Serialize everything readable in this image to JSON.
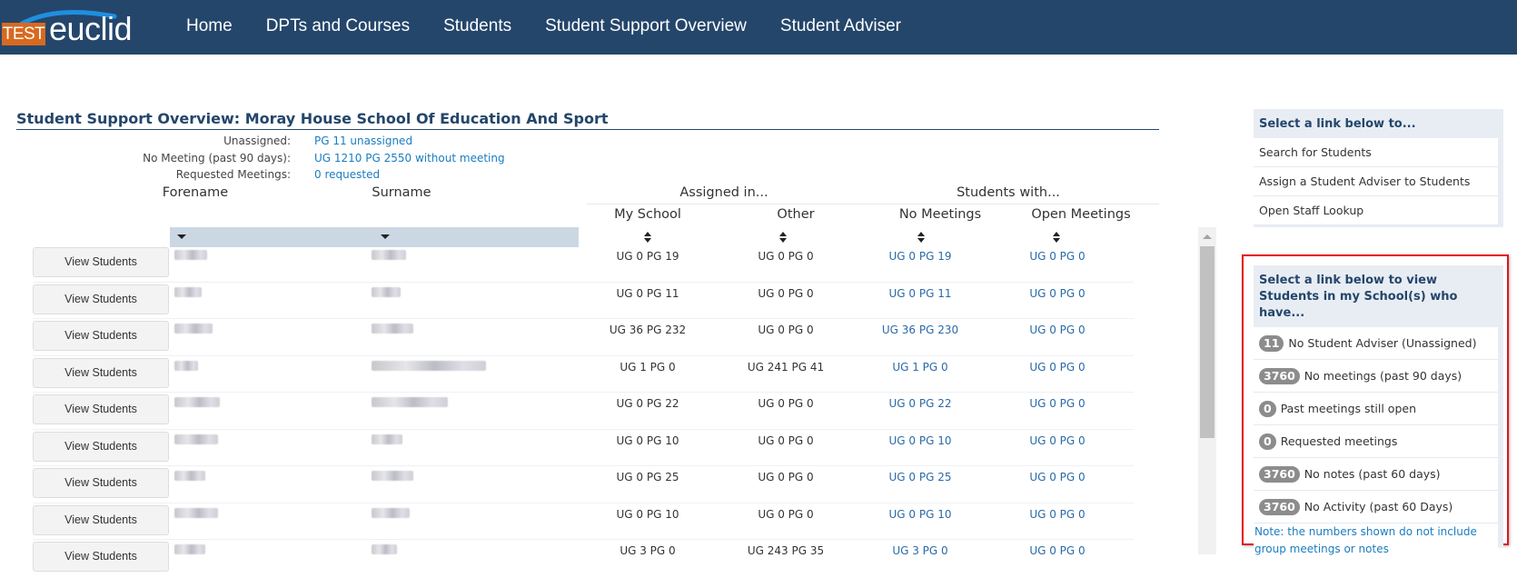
{
  "app": {
    "logo_prefix": "TEST",
    "logo_name": "euclid",
    "brand_color": "#24466b",
    "logo_accent": "#d8691f"
  },
  "nav": {
    "items": [
      {
        "label": "Home"
      },
      {
        "label": "DPTs and Courses"
      },
      {
        "label": "Students"
      },
      {
        "label": "Student Support Overview"
      },
      {
        "label": "Student Adviser"
      }
    ]
  },
  "main": {
    "title": "Student Support Overview: Moray House School Of Education And Sport",
    "summary": [
      {
        "label": "Unassigned:",
        "value": "PG 11 unassigned"
      },
      {
        "label": "No Meeting (past 90 days):",
        "value": "UG 1210 PG 2550 without meeting"
      },
      {
        "label": "Requested Meetings:",
        "value": "0 requested"
      }
    ],
    "table": {
      "columns": {
        "forename": "Forename",
        "surname": "Surname",
        "group_assigned": "Assigned in...",
        "group_students": "Students with...",
        "my_school": "My School",
        "other": "Other",
        "no_meetings": "No Meetings",
        "open_meetings": "Open Meetings"
      },
      "row_button_label": "View Students",
      "rows": [
        {
          "forename": "(redacted)",
          "surname": "(redacted)",
          "my_school": "UG 0 PG 19",
          "other": "UG 0 PG 0",
          "no_meetings": "UG 0 PG 19",
          "open_meetings": "UG 0 PG 0"
        },
        {
          "forename": "(redacted)",
          "surname": "(redacted)",
          "my_school": "UG 0 PG 11",
          "other": "UG 0 PG 0",
          "no_meetings": "UG 0 PG 11",
          "open_meetings": "UG 0 PG 0"
        },
        {
          "forename": "(redacted)",
          "surname": "(redacted)",
          "my_school": "UG 36 PG 232",
          "other": "UG 0 PG 0",
          "no_meetings": "UG 36 PG 230",
          "open_meetings": "UG 0 PG 0"
        },
        {
          "forename": "(redacted)",
          "surname": "(redacted)",
          "my_school": "UG 1 PG 0",
          "other": "UG 241 PG 41",
          "no_meetings": "UG 1 PG 0",
          "open_meetings": "UG 0 PG 0"
        },
        {
          "forename": "(redacted)",
          "surname": "(redacted)",
          "my_school": "UG 0 PG 22",
          "other": "UG 0 PG 0",
          "no_meetings": "UG 0 PG 22",
          "open_meetings": "UG 0 PG 0"
        },
        {
          "forename": "(redacted)",
          "surname": "(redacted)",
          "my_school": "UG 0 PG 10",
          "other": "UG 0 PG 0",
          "no_meetings": "UG 0 PG 10",
          "open_meetings": "UG 0 PG 0"
        },
        {
          "forename": "(redacted)",
          "surname": "(redacted)",
          "my_school": "UG 0 PG 25",
          "other": "UG 0 PG 0",
          "no_meetings": "UG 0 PG 25",
          "open_meetings": "UG 0 PG 0"
        },
        {
          "forename": "(redacted)",
          "surname": "(redacted)",
          "my_school": "UG 0 PG 10",
          "other": "UG 0 PG 0",
          "no_meetings": "UG 0 PG 10",
          "open_meetings": "UG 0 PG 0"
        },
        {
          "forename": "(redacted)",
          "surname": "(redacted)",
          "my_school": "UG 3 PG 0",
          "other": "UG 243 PG 35",
          "no_meetings": "UG 3 PG 0",
          "open_meetings": "UG 0 PG 0"
        }
      ]
    }
  },
  "sidebar": {
    "links_panel": {
      "heading": "Select a link below to...",
      "items": [
        {
          "label": "Search for Students"
        },
        {
          "label": "Assign a Student Adviser to Students"
        },
        {
          "label": "Open Staff Lookup"
        }
      ]
    },
    "counts_panel": {
      "heading": "Select a link below to view Students in my School(s) who have...",
      "items": [
        {
          "count": "11",
          "label": "No Student Adviser (Unassigned)"
        },
        {
          "count": "3760",
          "label": "No meetings (past 90 days)"
        },
        {
          "count": "0",
          "label": "Past meetings still open"
        },
        {
          "count": "0",
          "label": "Requested meetings"
        },
        {
          "count": "3760",
          "label": "No notes (past 60 days)"
        },
        {
          "count": "3760",
          "label": "No Activity (past 60 Days)"
        }
      ],
      "note": "Note: the numbers shown do not include group meetings or notes"
    }
  }
}
